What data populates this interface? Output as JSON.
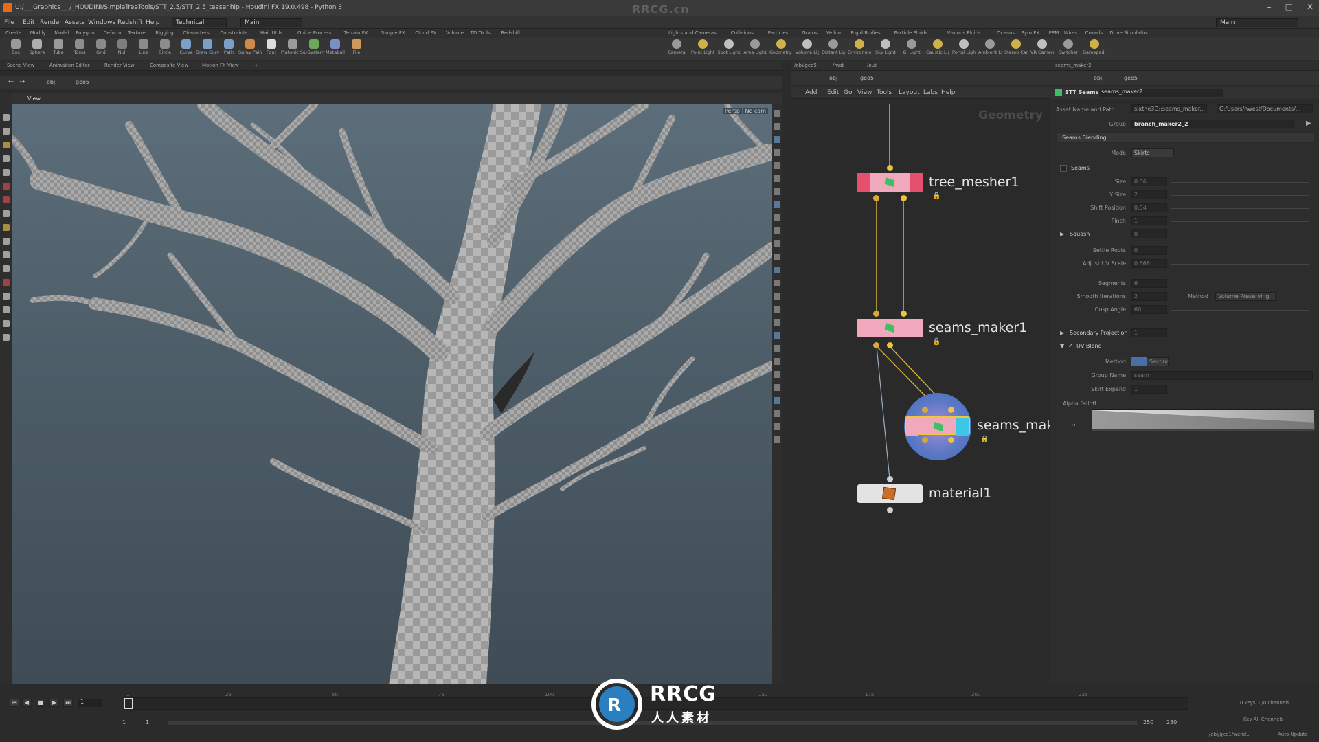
{
  "window": {
    "title": "U:/___Graphics___/_HOUDINI/SimpleTreeTools/STT_2.5/STT_2.5_teaser.hip - Houdini FX 19.0.498 - Python 3",
    "watermark": "RRCG.cn"
  },
  "menu": {
    "items": [
      "File",
      "Edit",
      "Render",
      "Assets",
      "Windows",
      "Redshift",
      "Help"
    ],
    "desktop_left": "Technical",
    "desktop_center": "Main",
    "desktop_right": "Main"
  },
  "shelf_tabs_left": [
    "Create",
    "Modify",
    "Model",
    "Polygon",
    "Deform",
    "Texture",
    "Rigging",
    "Characters",
    "Constraints",
    "Hair Utils",
    "Guide Process",
    "Terrain FX",
    "Simple FX",
    "Cloud FX",
    "Volume",
    "TD Tools",
    "Redshift"
  ],
  "shelf_tabs_right": [
    "Lights and Cameras",
    "Collisions",
    "Particles",
    "Grains",
    "Vellum",
    "Rigid Bodies",
    "Particle Fluids",
    "Viscous Fluids",
    "Oceans",
    "Pyro FX",
    "FEM",
    "Wires",
    "Crowds",
    "Drive Simulation"
  ],
  "tools_left": [
    "Box",
    "Sphere",
    "Tube",
    "Torus",
    "Grid",
    "Null",
    "Line",
    "Circle",
    "Curve",
    "Draw Curve",
    "Path",
    "Spray Paint",
    "Font",
    "Platonic Solids",
    "L-System",
    "Metaball",
    "File"
  ],
  "tools_right": [
    "Camera",
    "Point Light",
    "Spot Light",
    "Area Light",
    "Geometry Light",
    "Volume Light",
    "Distant Light",
    "Environment Light",
    "Sky Light",
    "GI Light",
    "Caustic Light",
    "Portal Light",
    "Ambient Light",
    "Stereo Camera",
    "VR Camera",
    "Switcher",
    "Gamepad Camera"
  ],
  "viewer": {
    "tabs": [
      "Scene View",
      "Animation Editor",
      "Render View",
      "Composite View",
      "Motion FX View"
    ],
    "path": [
      "obj",
      "geo5"
    ],
    "view_label": "View",
    "persp": "Persp",
    "cam": "No cam"
  },
  "network": {
    "tabs": [
      "/obj/geo5",
      "/mat",
      "/out"
    ],
    "path": [
      "obj",
      "geo5"
    ],
    "menu": [
      "Add",
      "Edit",
      "Go",
      "View",
      "Tools",
      "Layout",
      "Labs",
      "Help"
    ],
    "context_label": "Geometry",
    "nodes": [
      {
        "name": "tree_mesher1"
      },
      {
        "name": "seams_maker1"
      },
      {
        "name": "seams_mak"
      },
      {
        "name": "material1"
      }
    ]
  },
  "params": {
    "tabs": [
      "seams_maker2"
    ],
    "path": [
      "obj",
      "geo5"
    ],
    "node_type": "STT Seams",
    "node_name": "seams_maker2",
    "asset_label": "Asset Name and Path",
    "asset_name": "sixthe3D::seams_maker...",
    "asset_path": "C:/Users/nwest/Documents/...",
    "group_label": "Group",
    "group_value": "branch_maker2_2",
    "folder": "Seams Blending",
    "mode_label": "Mode",
    "mode_value": "Skirts",
    "seams_label": "Seams",
    "rows": [
      {
        "label": "Size",
        "value": "0.06"
      },
      {
        "label": "Y Size",
        "value": "2"
      },
      {
        "label": "Shift Position",
        "value": "0.04"
      },
      {
        "label": "Pinch",
        "value": "1"
      }
    ],
    "squash_label": "Squash",
    "squash_value": "0",
    "rows2": [
      {
        "label": "Settle Roots",
        "value": "0"
      },
      {
        "label": "Adjust UV Scale",
        "value": "0.666"
      },
      {
        "label": "Segments",
        "value": "6"
      },
      {
        "label": "Smooth Iterations",
        "value": "2"
      },
      {
        "label": "Cusp Angle",
        "value": "60"
      }
    ],
    "method_label": "Method",
    "method_value": "Volume Preserving",
    "secondary_label": "Secondary Projection",
    "secondary_value": "1",
    "uvblend_label": "UV Blend",
    "uv_method_label": "Method",
    "uv_method_value": "Second",
    "group_name_label": "Group Name",
    "group_name_value": "seam",
    "skirt_label": "Skirt Expand",
    "skirt_value": "1",
    "alpha_label": "Alpha Falloff"
  },
  "timeline": {
    "frame": "1",
    "ticks": [
      "1",
      "25",
      "50",
      "75",
      "100",
      "125",
      "150",
      "175",
      "200",
      "225"
    ],
    "start": "1",
    "start2": "1",
    "end": "250",
    "end2": "250",
    "keys": "0 keys, 0/0 channels",
    "key_all": "Key All Channels",
    "path": "/obj/geo1/wend...",
    "auto_update": "Auto Update"
  },
  "logo": {
    "text1": "RRCG",
    "text2": "人人素材"
  },
  "colors": {
    "node_pink": "#f0a8bd",
    "node_flag": "#e5506f",
    "wire_yellow": "#d9b23a",
    "node_accent_cyan": "#3ec6e6",
    "node_blue_circle": "#3c6fbf",
    "logo_blue": "#2a7fc0"
  }
}
